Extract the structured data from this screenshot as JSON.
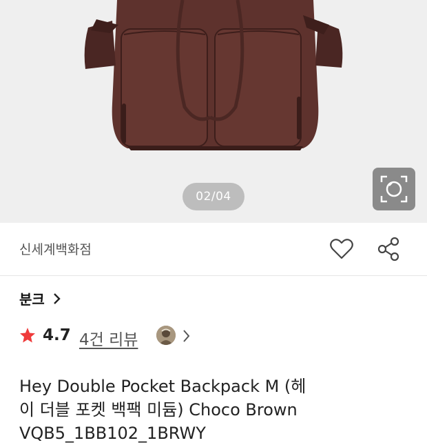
{
  "hero": {
    "page_indicator": "02/04",
    "lens_icon": "camera-lens-search-icon",
    "colors": {
      "background": "#efefef",
      "bag": "#5a2f2b",
      "bag_dark": "#3f1f1c"
    }
  },
  "store": {
    "name": "신세계백화점",
    "heart_icon": "heart-icon",
    "share_icon": "share-icon"
  },
  "brand": {
    "name": "분크",
    "chevron_icon": "chevron-right-icon"
  },
  "rating": {
    "score": "4.7",
    "review_link": "4건 리뷰",
    "star_color": "#ef3b3b"
  },
  "product": {
    "title_line1": "Hey Double Pocket Backpack M (헤",
    "title_line2": "이 더블 포켓 백팩 미듐) Choco Brown",
    "title_line3": "VQB5_1BB102_1BRWY"
  }
}
